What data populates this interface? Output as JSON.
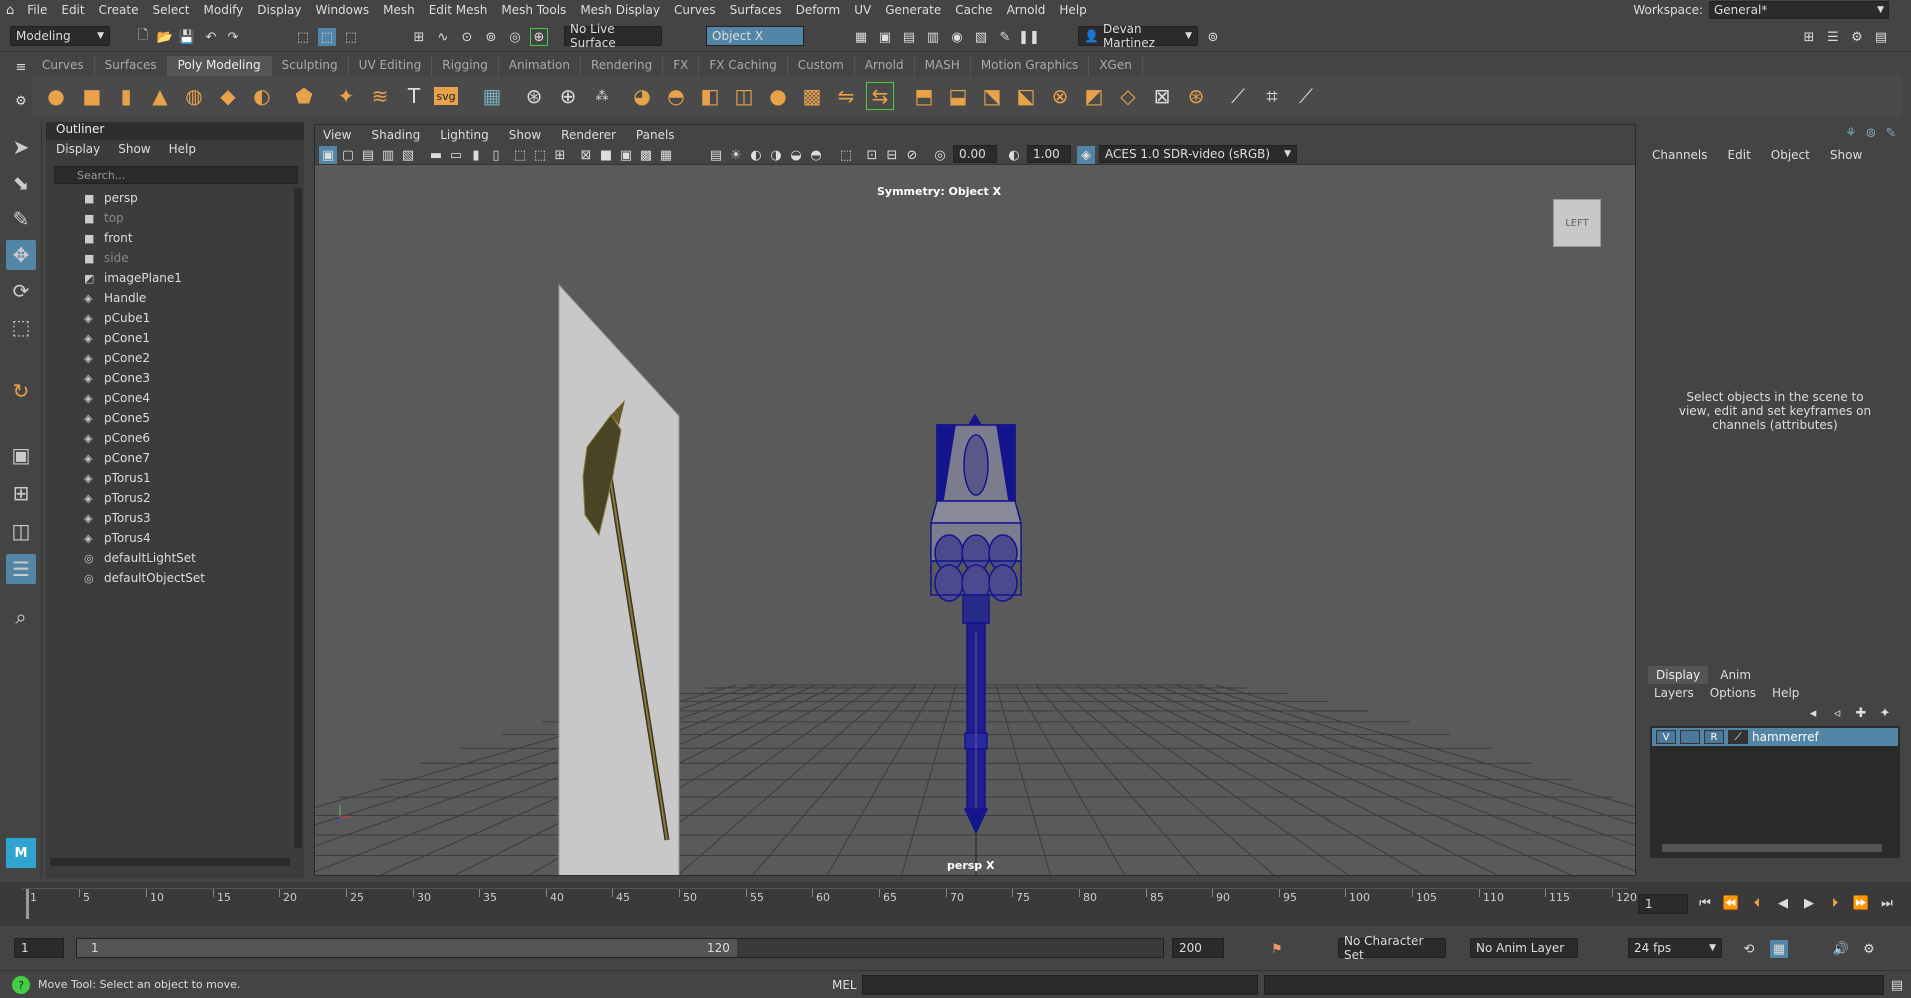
{
  "menubar": {
    "items": [
      "File",
      "Edit",
      "Create",
      "Select",
      "Modify",
      "Display",
      "Windows",
      "Mesh",
      "Edit Mesh",
      "Mesh Tools",
      "Mesh Display",
      "Curves",
      "Surfaces",
      "Deform",
      "UV",
      "Generate",
      "Cache",
      "Arnold",
      "Help"
    ],
    "workspace_label": "Workspace:",
    "workspace_value": "General*"
  },
  "statusline": {
    "mode": "Modeling",
    "live_surface": "No Live Surface",
    "symmetry": "Object X",
    "user": "Devan Martinez"
  },
  "shelf": {
    "tabs": [
      "Curves",
      "Surfaces",
      "Poly Modeling",
      "Sculpting",
      "UV Editing",
      "Rigging",
      "Animation",
      "Rendering",
      "FX",
      "FX Caching",
      "Custom",
      "Arnold",
      "MASH",
      "Motion Graphics",
      "XGen"
    ],
    "active_tab": "Poly Modeling",
    "svg_label": "svg",
    "text_label": "T"
  },
  "outliner": {
    "title": "Outliner",
    "menus": [
      "Display",
      "Show",
      "Help"
    ],
    "search_placeholder": "Search...",
    "items": [
      {
        "label": "persp",
        "type": "camera",
        "dim": false
      },
      {
        "label": "top",
        "type": "camera",
        "dim": true
      },
      {
        "label": "front",
        "type": "camera",
        "dim": false
      },
      {
        "label": "side",
        "type": "camera",
        "dim": true
      },
      {
        "label": "imagePlane1",
        "type": "image",
        "dim": false
      },
      {
        "label": "Handle",
        "type": "mesh",
        "dim": false
      },
      {
        "label": "pCube1",
        "type": "mesh",
        "dim": false
      },
      {
        "label": "pCone1",
        "type": "mesh",
        "dim": false
      },
      {
        "label": "pCone2",
        "type": "mesh",
        "dim": false
      },
      {
        "label": "pCone3",
        "type": "mesh",
        "dim": false
      },
      {
        "label": "pCone4",
        "type": "mesh",
        "dim": false
      },
      {
        "label": "pCone5",
        "type": "mesh",
        "dim": false
      },
      {
        "label": "pCone6",
        "type": "mesh",
        "dim": false
      },
      {
        "label": "pCone7",
        "type": "mesh",
        "dim": false
      },
      {
        "label": "pTorus1",
        "type": "mesh",
        "dim": false
      },
      {
        "label": "pTorus2",
        "type": "mesh",
        "dim": false
      },
      {
        "label": "pTorus3",
        "type": "mesh",
        "dim": false
      },
      {
        "label": "pTorus4",
        "type": "mesh",
        "dim": false
      },
      {
        "label": "defaultLightSet",
        "type": "set",
        "dim": false
      },
      {
        "label": "defaultObjectSet",
        "type": "set",
        "dim": false
      }
    ]
  },
  "viewport": {
    "menus": [
      "View",
      "Shading",
      "Lighting",
      "Show",
      "Renderer",
      "Panels"
    ],
    "exposure": "0.00",
    "gamma": "1.00",
    "color_space": "ACES 1.0 SDR-video (sRGB)",
    "symmetry_label": "Symmetry: Object X",
    "camera_label": "persp X",
    "view_cube": "LEFT"
  },
  "channelbox": {
    "menus": [
      "Channels",
      "Edit",
      "Object",
      "Show"
    ],
    "message": "Select objects in the scene to view, edit and set keyframes on channels (attributes)"
  },
  "layers": {
    "tabs": [
      "Display",
      "Anim"
    ],
    "menus": [
      "Layers",
      "Options",
      "Help"
    ],
    "layer_v": "V",
    "layer_r": "R",
    "layer_name": "hammerref"
  },
  "timeline": {
    "labels": [
      "1",
      "5",
      "10",
      "15",
      "20",
      "25",
      "30",
      "35",
      "40",
      "45",
      "50",
      "55",
      "60",
      "65",
      "70",
      "75",
      "80",
      "85",
      "90",
      "95",
      "100",
      "105",
      "110",
      "115",
      "120"
    ],
    "current_frame": "1"
  },
  "range": {
    "start": "1",
    "inner_start": "1",
    "inner_end": "120",
    "end": "200",
    "character_set": "No Character Set",
    "anim_layer": "No Anim Layer",
    "fps": "24 fps"
  },
  "cmdline": {
    "help_text": "Move Tool: Select an object to move.",
    "lang": "MEL"
  },
  "colors": {
    "accent": "#5285a6",
    "shelf_orange": "#e8a24a",
    "mesh_blue": "#1a1a8c"
  }
}
